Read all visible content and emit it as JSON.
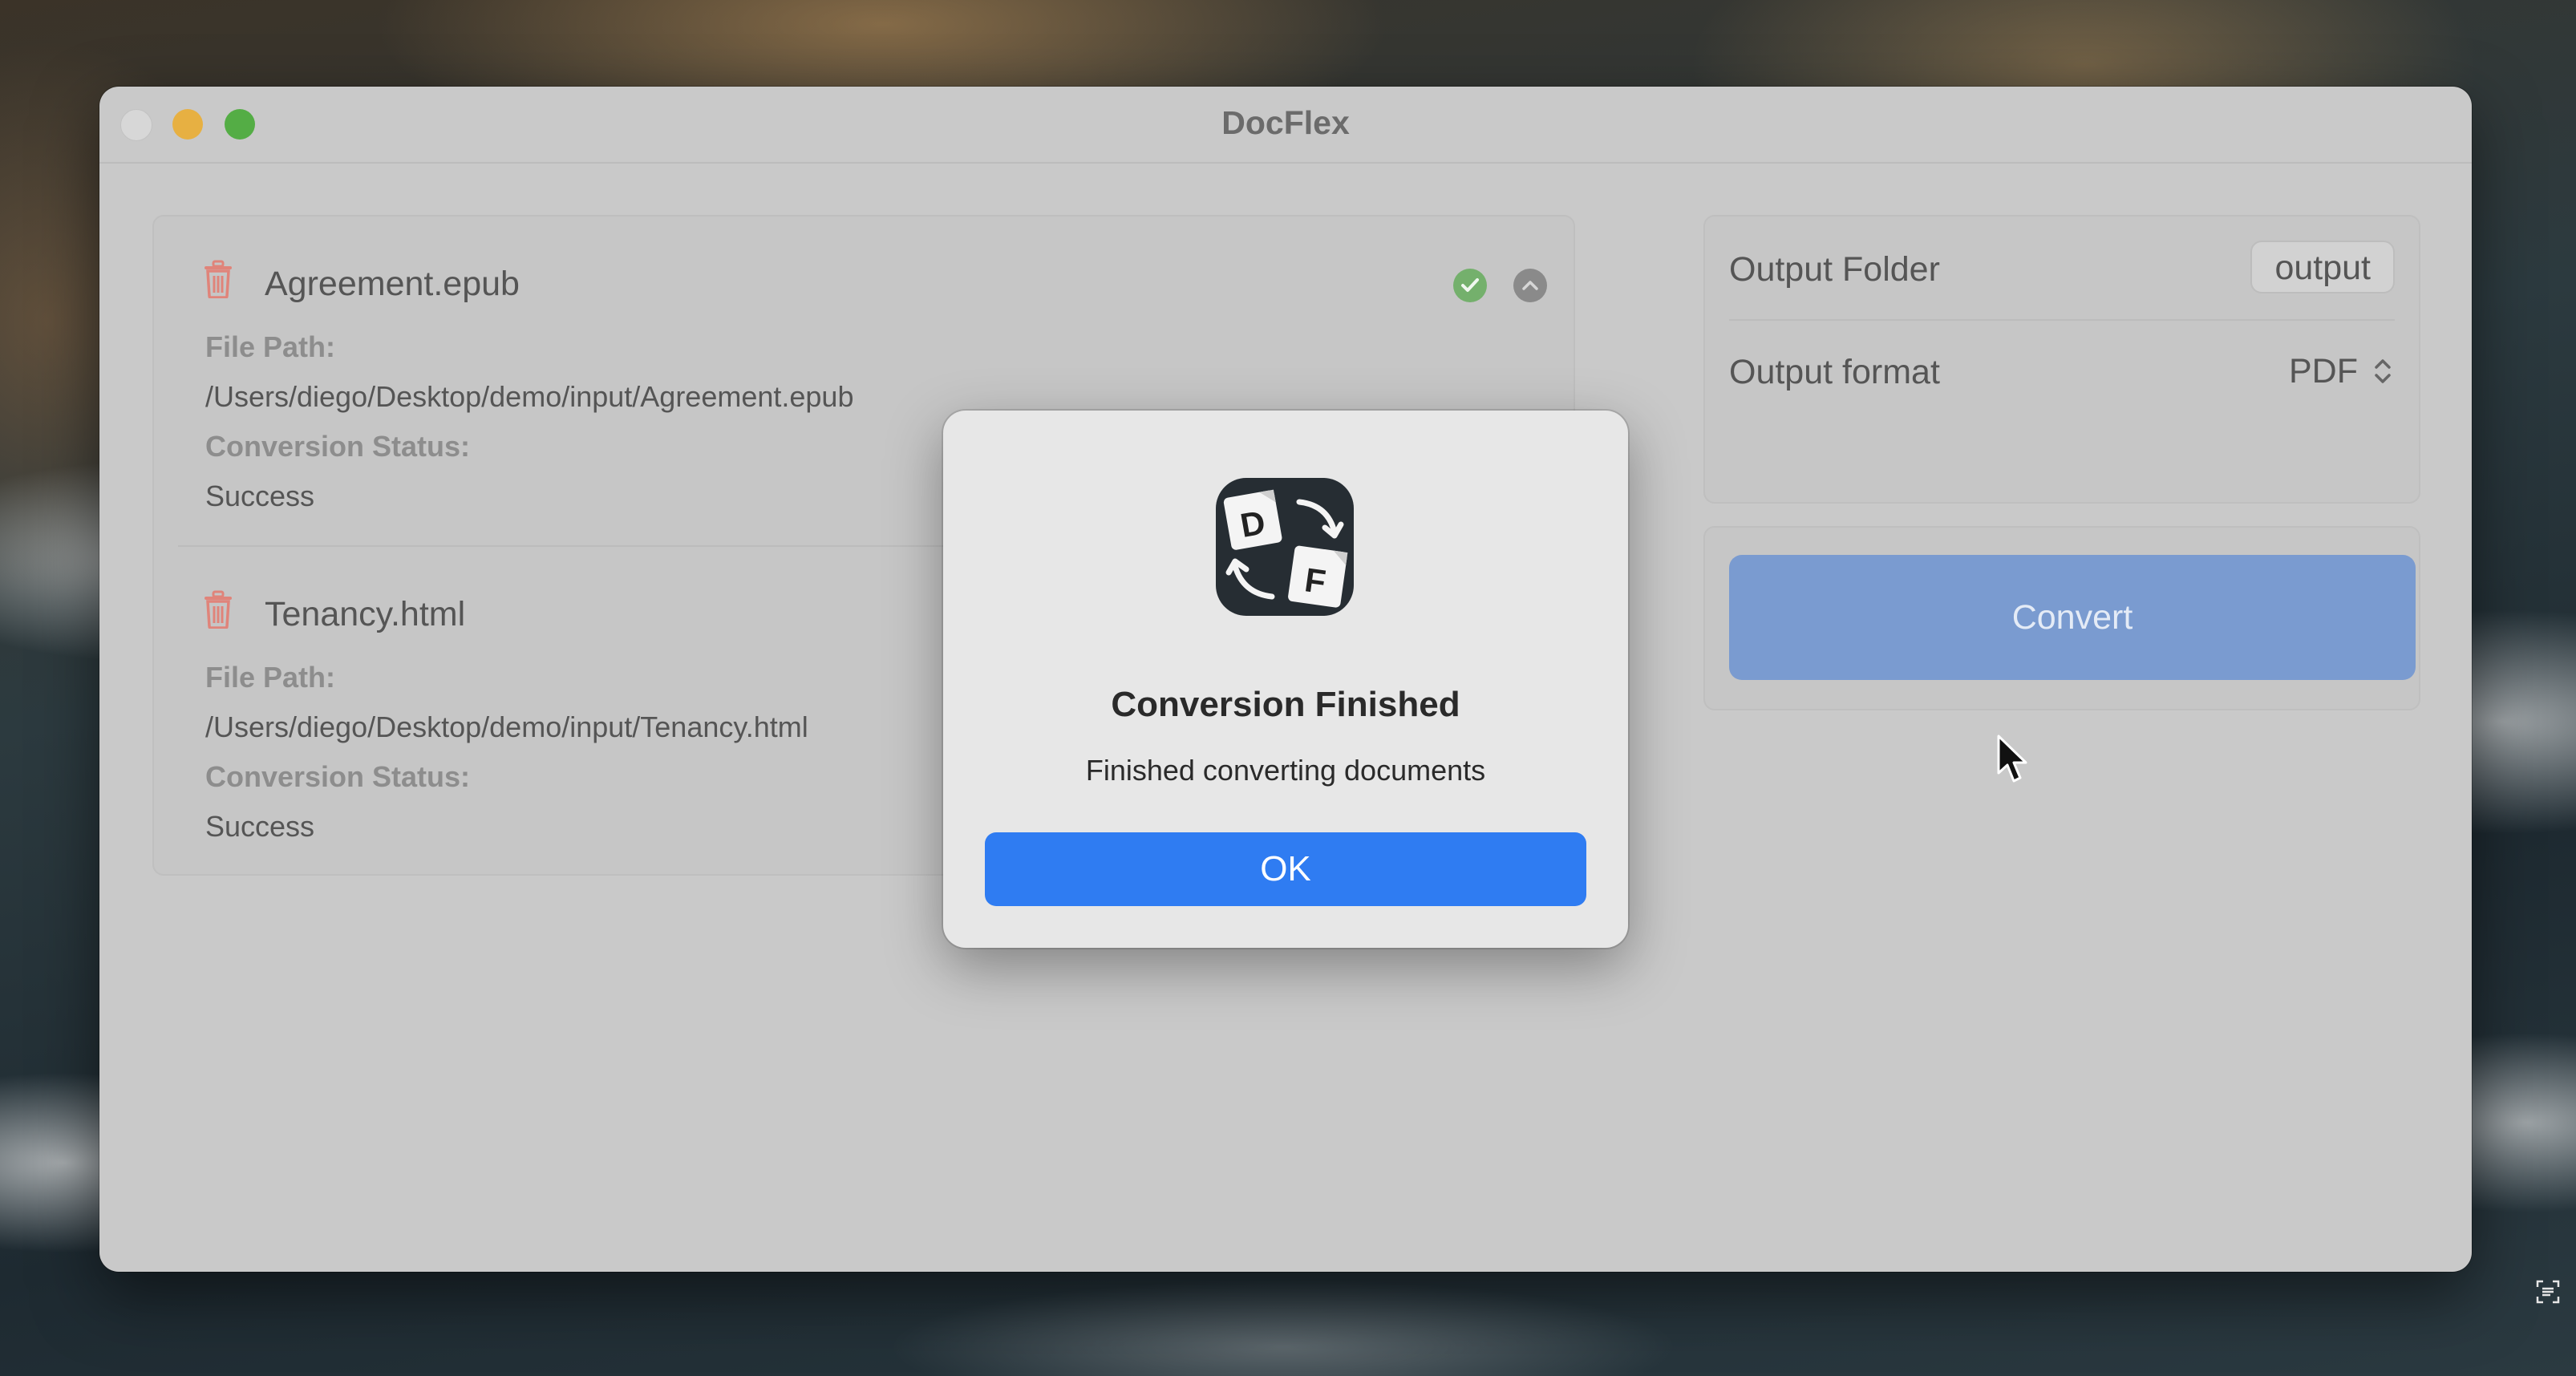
{
  "window": {
    "title": "DocFlex"
  },
  "files": [
    {
      "name": "Agreement.epub",
      "path_label": "File Path:",
      "path": "/Users/diego/Desktop/demo/input/Agreement.epub",
      "status_label": "Conversion Status:",
      "status": "Success"
    },
    {
      "name": "Tenancy.html",
      "path_label": "File Path:",
      "path": "/Users/diego/Desktop/demo/input/Tenancy.html",
      "status_label": "Conversion Status:",
      "status": "Success"
    }
  ],
  "settings": {
    "output_folder_label": "Output Folder",
    "output_folder_value": "output",
    "output_format_label": "Output format",
    "output_format_value": "PDF"
  },
  "convert_label": "Convert",
  "dialog": {
    "title": "Conversion Finished",
    "message": "Finished converting documents",
    "ok_label": "OK"
  },
  "icons": {
    "file_delete": "trash-icon",
    "success": "checkmark-circle-icon",
    "collapse": "chevron-up-icon",
    "format_stepper": "up-down-chevron-icon"
  },
  "colors": {
    "accent": "#2f7cf2",
    "convert_button": "#7a9bd0",
    "delete_red": "#e0847a",
    "success_green": "#74b06c"
  }
}
